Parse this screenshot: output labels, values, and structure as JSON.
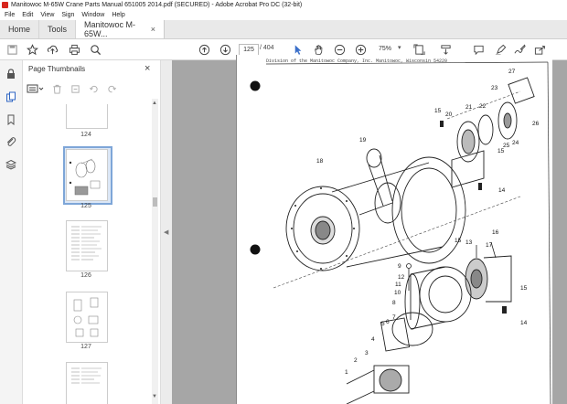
{
  "window": {
    "title": "Manitowoc M-65W Crane Parts Manual 651005 2014.pdf (SECURED) - Adobe Acrobat Pro DC (32-bit)"
  },
  "menu": [
    "File",
    "Edit",
    "View",
    "Sign",
    "Window",
    "Help"
  ],
  "tabs": {
    "home": "Home",
    "tools": "Tools",
    "document": "Manitowoc M-65W...",
    "close": "×"
  },
  "toolbar": {
    "page_number": "125",
    "page_count": "/ 404",
    "zoom": "75%"
  },
  "panel": {
    "title": "Page Thumbnails",
    "close": "×",
    "thumbnails": [
      {
        "label": "124"
      },
      {
        "label": "125",
        "selected": true
      },
      {
        "label": "126"
      },
      {
        "label": "127"
      }
    ]
  },
  "pdf": {
    "header_text": "Division of the Manitowoc Company, Inc.          Manitowoc, Wisconsin 54220",
    "callouts": [
      "27",
      "23",
      "15",
      "20",
      "21",
      "22",
      "26",
      "25",
      "24",
      "15",
      "19",
      "18",
      "14",
      "15",
      "13",
      "17",
      "16",
      "9",
      "12",
      "11",
      "10",
      "8",
      "15",
      "14",
      "5",
      "4",
      "3",
      "2",
      "7",
      "6",
      "1"
    ]
  },
  "icons": {
    "toolbar": [
      "save-icon",
      "bookmark-star-icon",
      "upload-icon",
      "print-icon",
      "search-zoom-icon",
      "page-up-icon",
      "page-down-icon",
      "select-cursor-icon",
      "hand-icon",
      "zoom-out-icon",
      "zoom-in-icon",
      "fit-page-icon",
      "scroll-mode-icon",
      "comment-icon",
      "highlight-icon",
      "sign-icon",
      "share-icon"
    ],
    "rail": [
      "lock-icon",
      "pages-icon",
      "bookmark-icon",
      "attachment-icon",
      "layers-icon"
    ]
  }
}
